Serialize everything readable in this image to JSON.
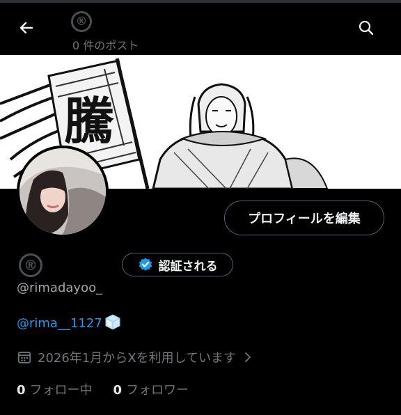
{
  "header": {
    "registered_mark": "®",
    "post_count": "0 件のポスト",
    "back_icon": "arrow-left-icon",
    "search_icon": "search-icon"
  },
  "banner": {
    "flag_character": "騰",
    "description_icon": "manga-warrior-banner"
  },
  "profile": {
    "edit_label": "プロフィールを編集",
    "name_mark": "®",
    "verify_label": "認証される",
    "handle": "@rimadayoo_",
    "bio_link": "@rima__1127",
    "joined": "2026年1月からXを利用しています",
    "following_count": "0",
    "following_label": "フォロー中",
    "followers_count": "0",
    "followers_label": "フォロワー"
  },
  "colors": {
    "accent": "#1d9bf0",
    "background": "#000000",
    "muted": "#71767b"
  }
}
